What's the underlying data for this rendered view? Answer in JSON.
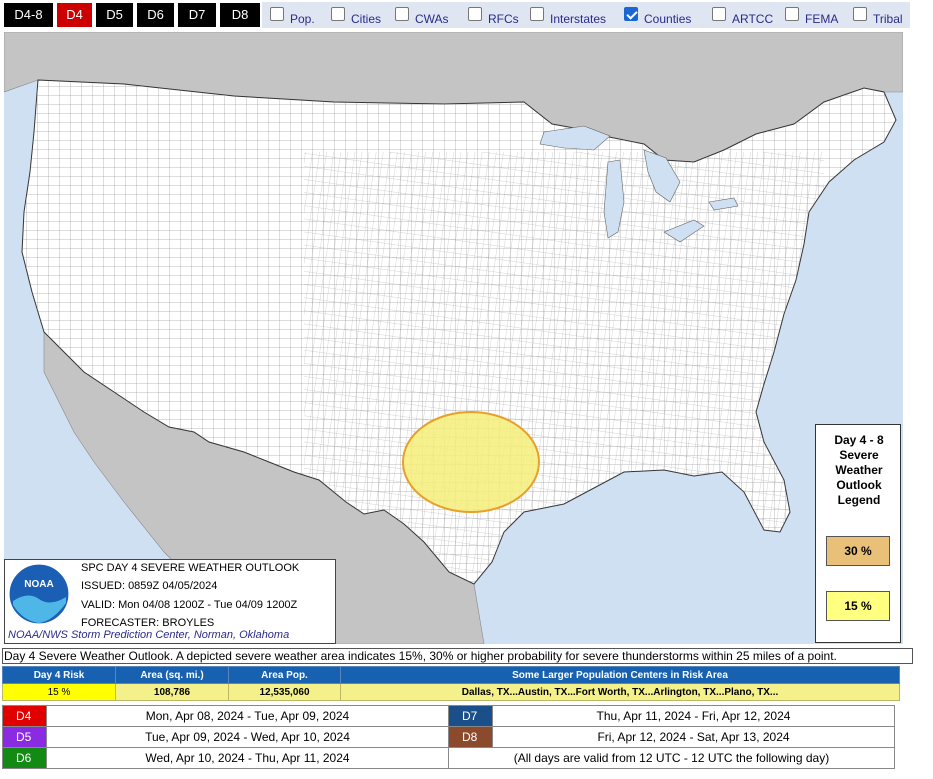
{
  "day_tabs": [
    {
      "label": "D4-8",
      "active": false
    },
    {
      "label": "D4",
      "active": true
    },
    {
      "label": "D5",
      "active": false
    },
    {
      "label": "D6",
      "active": false
    },
    {
      "label": "D7",
      "active": false
    },
    {
      "label": "D8",
      "active": false
    }
  ],
  "layers": [
    {
      "label": "Pop.",
      "checked": false
    },
    {
      "label": "Cities",
      "checked": false
    },
    {
      "label": "CWAs",
      "checked": false
    },
    {
      "label": "RFCs",
      "checked": false
    },
    {
      "label": "Interstates",
      "checked": false
    },
    {
      "label": "Counties",
      "checked": true
    },
    {
      "label": "ARTCC",
      "checked": false
    },
    {
      "label": "FEMA",
      "checked": false
    },
    {
      "label": "Tribal",
      "checked": false
    }
  ],
  "legend": {
    "title": "Day 4 - 8\nSevere\nWeather\nOutlook\nLegend",
    "items": [
      {
        "label": "30 %",
        "color": "#e8c078"
      },
      {
        "label": "15 %",
        "color": "#ffff80"
      }
    ]
  },
  "infobox": {
    "logo_text": "NOAA",
    "lines": [
      "SPC DAY 4 SEVERE WEATHER OUTLOOK",
      "ISSUED: 0859Z 04/05/2024",
      "VALID: Mon 04/08 1200Z - Tue 04/09 1200Z",
      "FORECASTER: BROYLES"
    ],
    "credit": "NOAA/NWS Storm Prediction Center, Norman, Oklahoma"
  },
  "description": "Day 4 Severe Weather Outlook. A depicted severe weather area indicates 15%, 30% or higher probability for severe thunderstorms within 25 miles of a point.",
  "risk_table": {
    "headers": [
      "Day 4 Risk",
      "Area (sq. mi.)",
      "Area Pop.",
      "Some Larger Population Centers in Risk Area"
    ],
    "row": [
      "15 %",
      "108,786",
      "12,535,060",
      "Dallas, TX...Austin, TX...Fort Worth, TX...Arlington, TX...Plano, TX..."
    ]
  },
  "day_table": [
    {
      "badge": "D4",
      "color": "#e00000",
      "text": "Mon, Apr 08, 2024 - Tue, Apr 09, 2024",
      "badge2": "D7",
      "color2": "#1a4f8a",
      "text2": "Thu, Apr 11, 2024 - Fri, Apr 12, 2024"
    },
    {
      "badge": "D5",
      "color": "#8a2be2",
      "text": "Tue, Apr 09, 2024 - Wed, Apr 10, 2024",
      "badge2": "D8",
      "color2": "#8b4a2b",
      "text2": "Fri, Apr 12, 2024 - Sat, Apr 13, 2024"
    },
    {
      "badge": "D6",
      "color": "#138a13",
      "text": "Wed, Apr 10, 2024 - Thu, Apr 11, 2024",
      "badge2": "",
      "color2": "#ffffff",
      "text2": "(All days are valid from 12 UTC - 12 UTC the following day)"
    }
  ],
  "colors": {
    "water": "#cfe0f2",
    "foreign_land": "#c4c4c4",
    "us_land": "#ffffff",
    "risk_15": "#f4ef78",
    "risk_15_border": "#e8a02a",
    "header_blue": "#1761b0"
  }
}
